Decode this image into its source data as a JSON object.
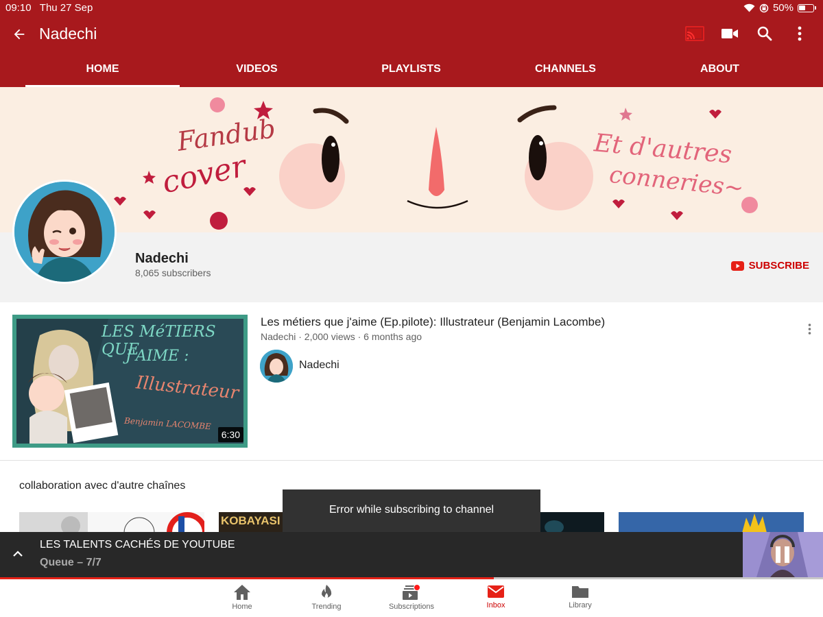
{
  "status_bar": {
    "time": "09:10",
    "date": "Thu 27 Sep",
    "battery": "50%"
  },
  "appbar": {
    "title": "Nadechi"
  },
  "tabs": [
    {
      "label": "HOME",
      "active": true
    },
    {
      "label": "VIDEOS",
      "active": false
    },
    {
      "label": "PLAYLISTS",
      "active": false
    },
    {
      "label": "CHANNELS",
      "active": false
    },
    {
      "label": "ABOUT",
      "active": false
    }
  ],
  "banner": {
    "left_text_1": "Fandub",
    "left_text_2": "cover",
    "right_text_1": "Et d'autres",
    "right_text_2": "conneries~"
  },
  "channel": {
    "name": "Nadechi",
    "subscribers": "8,065 subscribers",
    "subscribe_label": "SUBSCRIBE"
  },
  "featured_video": {
    "title": "Les métiers que j'aime (Ep.pilote): Illustrateur (Benjamin Lacombe)",
    "meta": "Nadechi · 2,000 views · 6 months ago",
    "channel_name": "Nadechi",
    "duration": "6:30",
    "thumb_text_1": "LES MéTIERS QUE",
    "thumb_text_2": "J'AIME :",
    "thumb_text_3": "Illustrateur",
    "thumb_text_4": "Benjamin LACOMBE"
  },
  "section": {
    "title": "collaboration avec d'autre chaînes",
    "shelf_label_2": "KOBAYASI"
  },
  "toast": {
    "message": "Error while subscribing to channel"
  },
  "miniplayer": {
    "title": "LES TALENTS CACHÉS DE YOUTUBE",
    "subtitle": "Queue – 7/7",
    "progress": 0.6
  },
  "bottom_nav": [
    {
      "label": "Home",
      "icon": "home-icon",
      "active": false
    },
    {
      "label": "Trending",
      "icon": "flame-icon",
      "active": false
    },
    {
      "label": "Subscriptions",
      "icon": "subscriptions-icon",
      "active": false
    },
    {
      "label": "Inbox",
      "icon": "inbox-icon",
      "active": true
    },
    {
      "label": "Library",
      "icon": "folder-icon",
      "active": false
    }
  ],
  "colors": {
    "brand_red": "#a8191d",
    "accent_red": "#cc0000",
    "banner_bg": "#fbeee2",
    "teal": "#3e9b86"
  }
}
